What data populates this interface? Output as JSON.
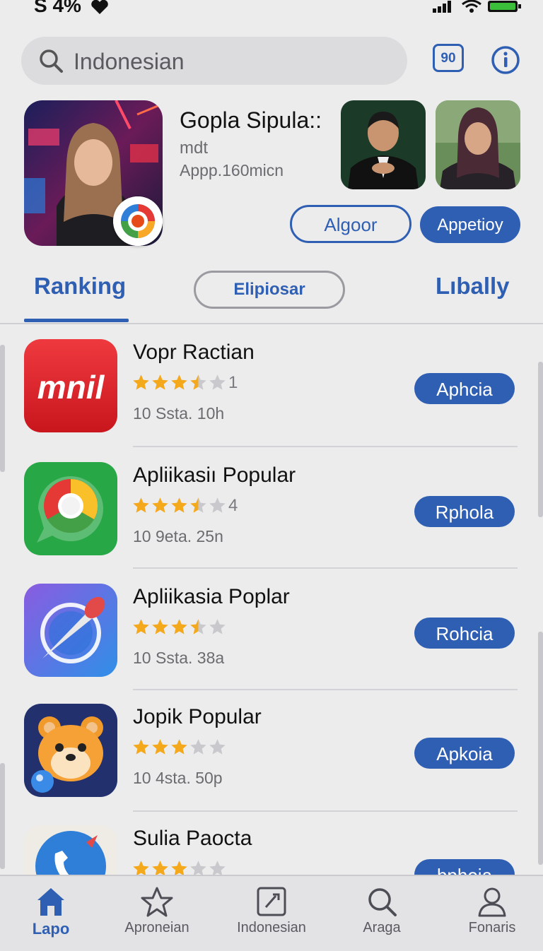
{
  "status_bar": {
    "left_text": "S 4%"
  },
  "search": {
    "value": "Indonesian"
  },
  "header": {
    "badge_label": "90"
  },
  "featured": {
    "title": "Gopla Sipula::",
    "subtitle": "mdt",
    "meta": "Appp.160micn",
    "buttons": {
      "outline_label": "Algoor",
      "solid_label": "Appetioy"
    }
  },
  "tabs": [
    {
      "label": "Ranking",
      "active": true
    },
    {
      "label": "Elipiosar",
      "active": false
    },
    {
      "label": "Lıbally",
      "active": false
    }
  ],
  "apps": [
    {
      "name": "Vopr Ractian",
      "rating_text": "1",
      "stars": 3.5,
      "meta": "10 Ssta. 10h",
      "button": "Aphcia",
      "icon": "mail-icon",
      "icon_text": "mnil",
      "color": "#d9252b"
    },
    {
      "name": "Apliikasiı Popular",
      "rating_text": "4",
      "stars": 3.5,
      "meta": "10 9eta. 25n",
      "button": "Rphola",
      "icon": "chat-browser-icon",
      "color": "#27a746"
    },
    {
      "name": "Apliikasia Poplar",
      "rating_text": "",
      "stars": 3.5,
      "meta": "10 Ssta. 38a",
      "button": "Rohcia",
      "icon": "compass-icon",
      "color": "#5d6be0"
    },
    {
      "name": "Jopik Popular",
      "rating_text": "",
      "stars": 3,
      "meta": "10 4sta. 50p",
      "button": "Apkoia",
      "icon": "hamster-icon",
      "color": "#2b3a8a"
    },
    {
      "name": "Sulia Paocta",
      "rating_text": "",
      "stars": 3,
      "meta": "",
      "button": "bphoia",
      "icon": "phone-icon",
      "color": "#2f7fd8"
    }
  ],
  "bottom_nav": [
    {
      "label": "Lapo",
      "icon": "home-icon",
      "active": true
    },
    {
      "label": "Apronеian",
      "icon": "star-icon",
      "active": false
    },
    {
      "label": "Indonesian",
      "icon": "pen-square-icon",
      "active": false
    },
    {
      "label": "Araga",
      "icon": "search-icon",
      "active": false
    },
    {
      "label": "Fonaris",
      "icon": "person-icon",
      "active": false
    }
  ],
  "colors": {
    "accent": "#2f5fb3",
    "star": "#f4a81c",
    "background": "#ececed"
  }
}
